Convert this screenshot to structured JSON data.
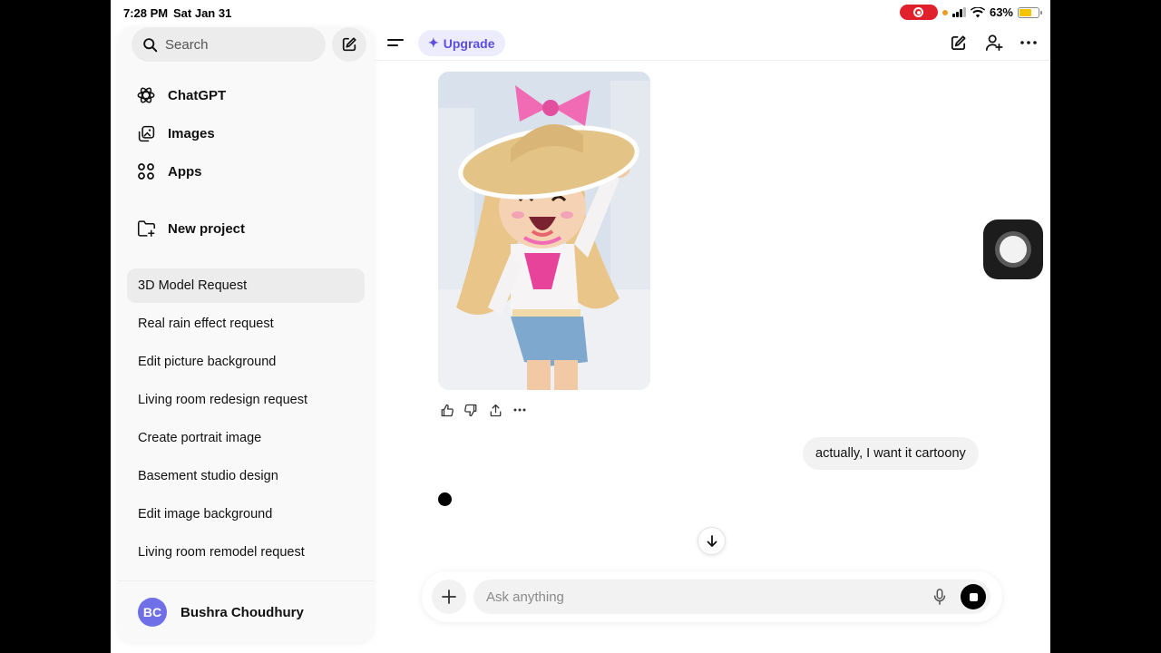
{
  "status_bar": {
    "time": "7:28 PM",
    "date": "Sat Jan 31",
    "battery": "63%",
    "battery_level": 0.63
  },
  "sidebar": {
    "search": {
      "label": "Search"
    },
    "nav": [
      {
        "label": "ChatGPT",
        "icon": "chatgpt-logo-icon"
      },
      {
        "label": "Images",
        "icon": "images-icon"
      },
      {
        "label": "Apps",
        "icon": "apps-grid-icon"
      },
      {
        "label": "New project",
        "icon": "new-project-folder-icon"
      }
    ],
    "history": [
      "3D Model Request",
      "Real rain effect request",
      "Edit picture background",
      "Living room redesign request",
      "Create portrait image",
      "Basement studio design",
      "Edit image background",
      "Living room remodel request"
    ],
    "active_history_index": 0,
    "profile": {
      "initials": "BC",
      "name": "Bushra Choudhury",
      "avatar_color": "#6f6fe8"
    }
  },
  "topbar": {
    "upgrade_label": "Upgrade",
    "accent": "#5b4ee0"
  },
  "conversation": {
    "user_message": "actually, I want it cartoony"
  },
  "composer": {
    "placeholder": "Ask anything"
  }
}
